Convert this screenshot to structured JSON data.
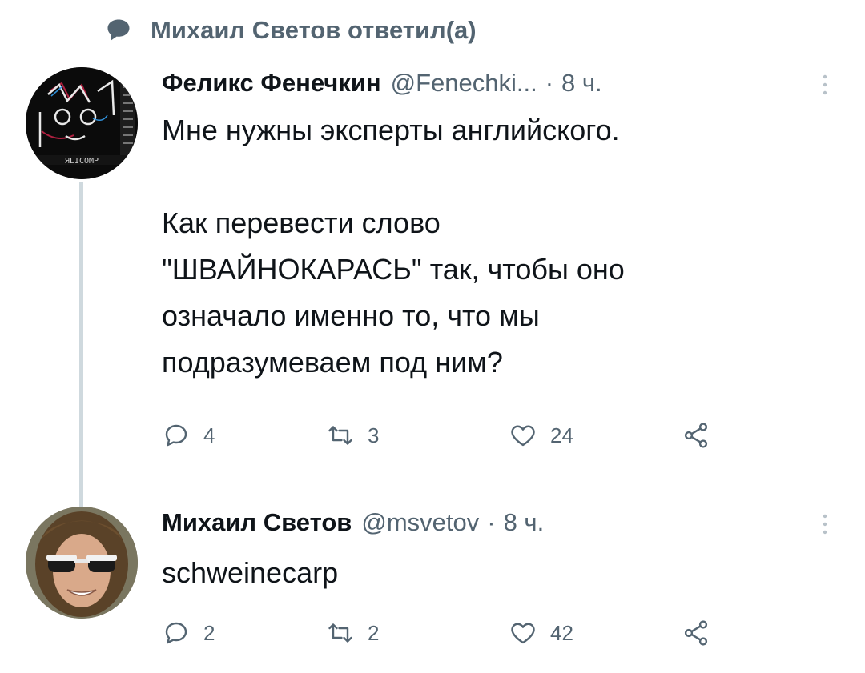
{
  "reply_context": {
    "text": "Михаил Светов ответил(а)",
    "icon": "reply-bubble-icon"
  },
  "tweets": [
    {
      "author_name": "Феликс Фенечкин",
      "handle": "@Fenechki...",
      "separator": "·",
      "time": "8 ч.",
      "text": "Мне нужны эксперты английского.\n\nКак перевести слово\n\"ШВАЙНОКАРАСЬ\" так, чтобы оно\nозначало именно то, что мы\nподразумеваем под ним?",
      "reply_count": "4",
      "retweet_count": "3",
      "like_count": "24",
      "avatar_text": "ЯLICOMP"
    },
    {
      "author_name": "Михаил Светов",
      "handle": "@msvetov",
      "separator": "·",
      "time": "8 ч.",
      "text": "schweinecarp",
      "reply_count": "2",
      "retweet_count": "2",
      "like_count": "42"
    }
  ],
  "colors": {
    "muted": "#536471",
    "text": "#0f1419",
    "line": "#cfd9de"
  }
}
